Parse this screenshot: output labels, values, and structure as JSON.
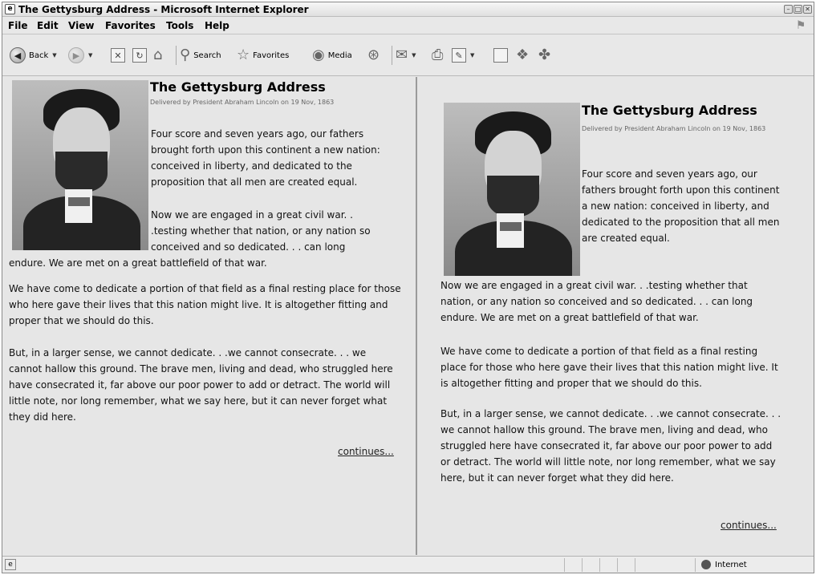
{
  "window": {
    "title": "The Gettysburg Address - Microsoft Internet Explorer"
  },
  "menu": [
    "File",
    "Edit",
    "View",
    "Favorites",
    "Tools",
    "Help"
  ],
  "toolbar": {
    "back": "Back",
    "search": "Search",
    "favorites": "Favorites",
    "media": "Media"
  },
  "left_doc": {
    "title": "The Gettysburg Address",
    "subtitle": "Delivered by President Abraham Lincoln on 19 Nov, 1863",
    "p1": "Four score and seven years ago, our fathers brought forth upon this continent a new nation: conceived in liberty, and dedicated to the proposition that all men are created equal.",
    "p2a": "Now we are engaged in a great civil war. . .testing whether that nation, or any nation so conceived and so dedicated. . . can long",
    "p2b": "endure. We are met on a great battlefield of that war.",
    "p3": "We have come to dedicate a portion of that field as a final resting place for those who here gave their lives that this nation might live. It is altogether fitting and proper that we should do this.",
    "p4": "But, in a larger sense, we cannot dedicate. . .we cannot consecrate. . . we cannot hallow this ground. The brave men, living and dead, who struggled here have consecrated it, far above our poor power to add or detract. The world will little note, nor long remember, what we say here, but it can never forget what they did here.",
    "continues": "continues..."
  },
  "right_doc": {
    "title": "The Gettysburg Address",
    "subtitle": "Delivered by President Abraham Lincoln on 19 Nov, 1863",
    "p1": "Four score and seven years ago, our fathers brought forth upon this continent a new nation: conceived in liberty, and dedicated to the proposition that all men are created equal.",
    "p2": "Now we are engaged in a great civil war. . .testing whether that nation, or any nation so conceived and so dedicated. . . can long endure. We are met on a great battlefield of that war.",
    "p3": "We have come to dedicate a portion of that field as a final resting place for those who here gave their lives that this nation might live. It is altogether fitting and proper that we should do this.",
    "p4": "But, in a larger sense, we cannot dedicate. . .we cannot consecrate. . . we cannot hallow this ground. The brave men, living and dead, who struggled here have consecrated it, far above our poor power to add or detract. The world will little note, nor long remember, what we say here, but it can never forget what they did here.",
    "continues": "continues..."
  },
  "status": {
    "zone": "Internet"
  },
  "icons": {
    "app": "ie-page-icon",
    "back": "back-arrow-icon",
    "forward": "forward-arrow-icon",
    "stop": "stop-icon",
    "refresh": "refresh-icon",
    "home": "home-icon",
    "search": "magnifier-icon",
    "favorites": "star-icon",
    "media": "media-icon",
    "history": "history-icon",
    "mail": "mail-icon",
    "print": "printer-icon",
    "edit": "edit-icon",
    "discuss": "discuss-icon",
    "messenger": "messenger-icon",
    "zone": "globe-icon"
  }
}
